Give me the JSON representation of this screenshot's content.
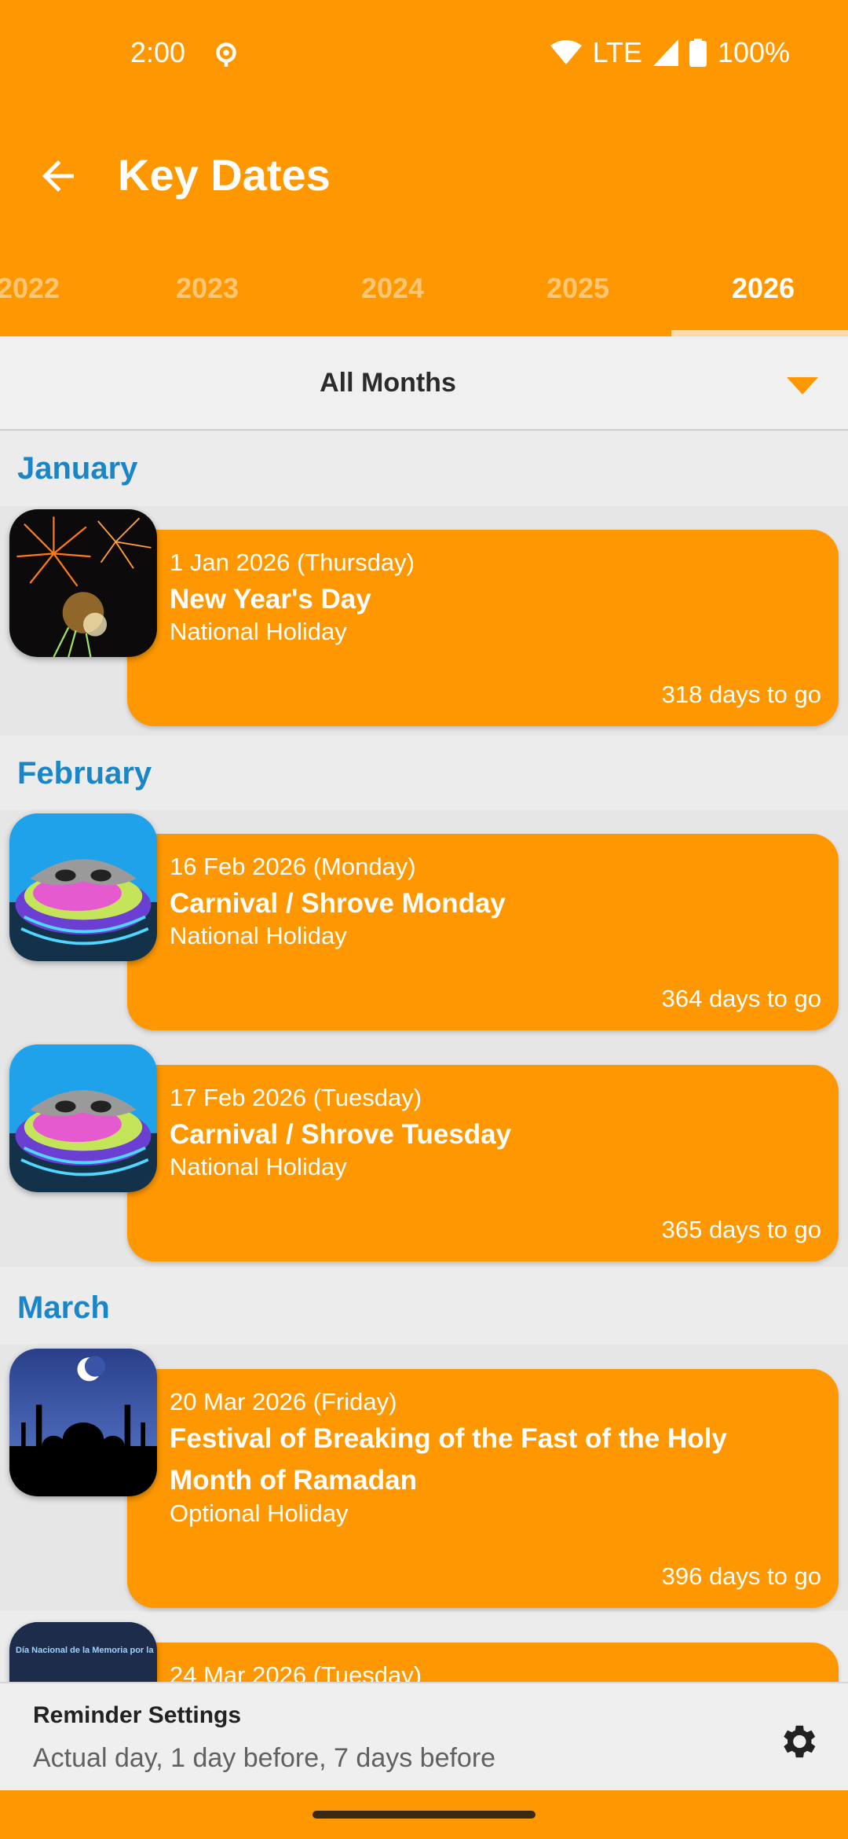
{
  "status": {
    "time": "2:00",
    "network": "LTE",
    "battery": "100%"
  },
  "toolbar": {
    "title": "Key Dates"
  },
  "tabs": [
    {
      "label": "2022"
    },
    {
      "label": "2023"
    },
    {
      "label": "2024"
    },
    {
      "label": "2025"
    },
    {
      "label": "2026"
    }
  ],
  "filter": {
    "label": "All Months"
  },
  "months": [
    {
      "name": "January"
    },
    {
      "name": "February"
    },
    {
      "name": "March"
    }
  ],
  "events": [
    {
      "date": "1 Jan 2026 (Thursday)",
      "name": "New Year's Day",
      "type": "National Holiday",
      "countdown": "318 days to go",
      "image": "fireworks"
    },
    {
      "date": "16 Feb 2026 (Monday)",
      "name": "Carnival / Shrove Monday",
      "type": "National Holiday",
      "countdown": "364 days to go",
      "image": "carnival-mask"
    },
    {
      "date": "17 Feb 2026 (Tuesday)",
      "name": "Carnival / Shrove Tuesday",
      "type": "National Holiday",
      "countdown": "365 days to go",
      "image": "carnival-mask"
    },
    {
      "date": "20 Mar 2026 (Friday)",
      "name": "Festival of Breaking of the Fast of the Holy Month of Ramadan",
      "type": "Optional Holiday",
      "countdown": "396 days to go",
      "image": "mosque-crescent"
    },
    {
      "date": "24 Mar 2026 (Tuesday)",
      "image": "memoria-banner",
      "image_text": "Día Nacional de la Memoria por la"
    }
  ],
  "reminder": {
    "title": "Reminder Settings",
    "subtitle": "Actual day, 1 day before, 7 days before"
  },
  "colors": {
    "accent": "#ff9800",
    "month_heading": "#1a86c8"
  }
}
